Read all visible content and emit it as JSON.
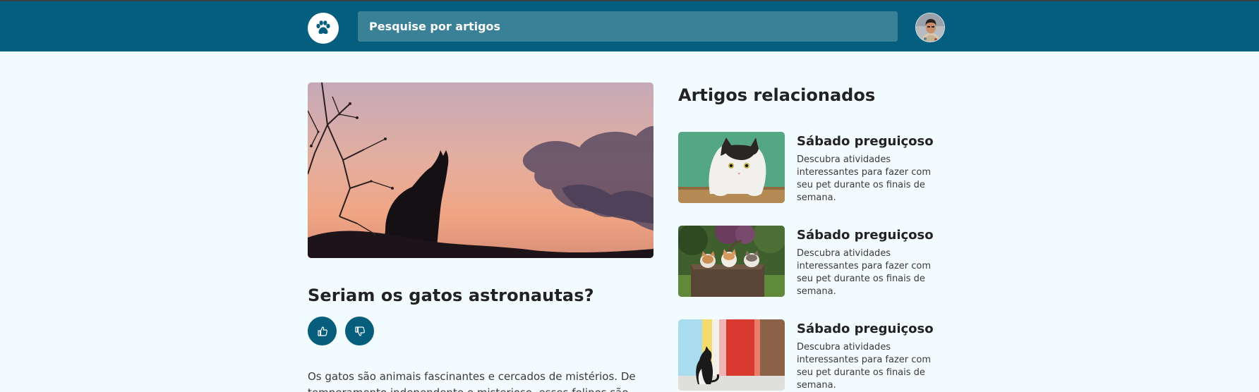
{
  "header": {
    "logo": "paw-icon",
    "search_placeholder": "Pesquise por artigos",
    "avatar": "user-avatar"
  },
  "article": {
    "title": "Seriam os gatos astronautas?",
    "like_icon": "thumbs-up-icon",
    "dislike_icon": "thumbs-down-icon",
    "body_line_1": "Os gatos são animais fascinantes e cercados de mistérios. De",
    "body_line_2": "temperamento independente e misterioso, esses felinos são"
  },
  "related": {
    "title": "Artigos relacionados",
    "items": [
      {
        "title": "Sábado preguiçoso",
        "description": "Descubra atividades interessantes para fazer com seu pet durante os finais de semana."
      },
      {
        "title": "Sábado preguiçoso",
        "description": "Descubra atividades interessantes para fazer com seu pet durante os finais de semana."
      },
      {
        "title": "Sábado preguiçoso",
        "description": "Descubra atividades interessantes para fazer com seu pet durante os finais de semana."
      }
    ]
  },
  "colors": {
    "header": "#055e7d",
    "background": "#f2fbfd",
    "accent": "#075e7c"
  }
}
